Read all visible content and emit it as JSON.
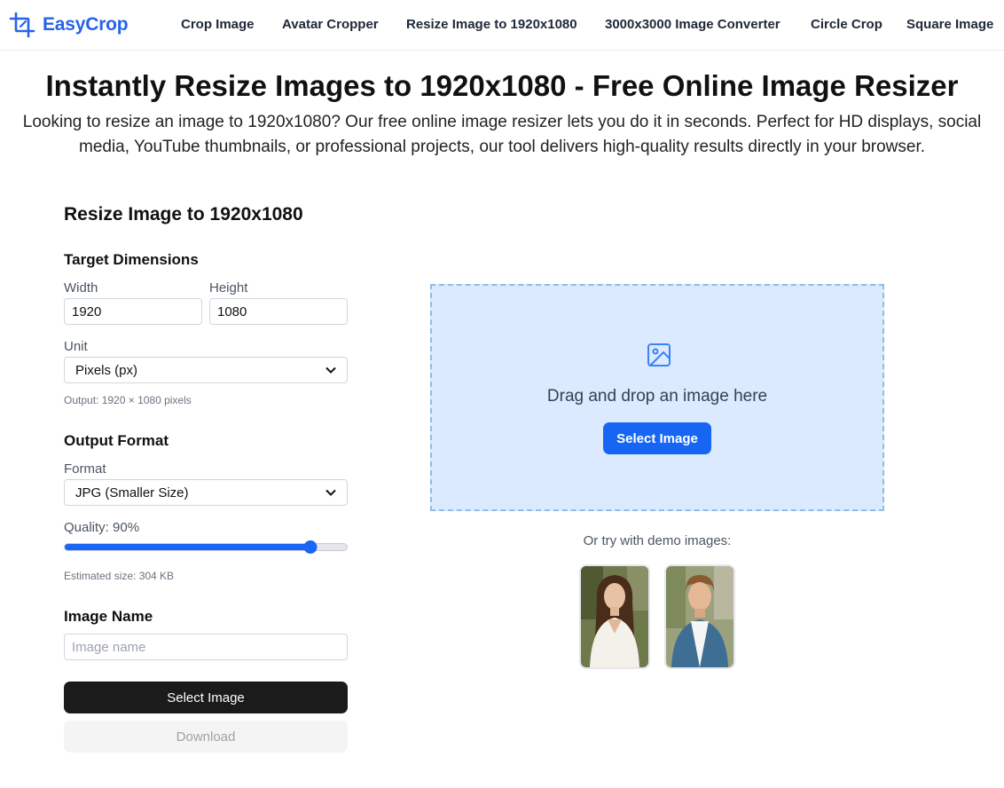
{
  "header": {
    "logo_text": "EasyCrop",
    "nav": [
      {
        "label": "Crop Image"
      },
      {
        "label": "Avatar Cropper"
      },
      {
        "label": "Resize Image to 1920x1080"
      },
      {
        "label": "3000x3000 Image Converter"
      },
      {
        "label": "Circle Crop"
      },
      {
        "label": "Square Image"
      }
    ]
  },
  "hero": {
    "title": "Instantly Resize Images to 1920x1080 - Free Online Image Resizer",
    "subtitle": "Looking to resize an image to 1920x1080? Our free online image resizer lets you do it in seconds. Perfect for HD displays, social media, YouTube thumbnails, or professional projects, our tool delivers high-quality results directly in your browser."
  },
  "panel": {
    "title": "Resize Image to 1920x1080",
    "dimensions": {
      "title": "Target Dimensions",
      "width_label": "Width",
      "width_value": "1920",
      "height_label": "Height",
      "height_value": "1080",
      "unit_label": "Unit",
      "unit_value": "Pixels (px)",
      "output_hint": "Output: 1920 × 1080 pixels"
    },
    "format": {
      "title": "Output Format",
      "format_label": "Format",
      "format_value": "JPG (Smaller Size)",
      "quality_label": "Quality: 90%",
      "quality_value": 90,
      "estimated_size": "Estimated size: 304 KB"
    },
    "image_name": {
      "title": "Image Name",
      "placeholder": "Image name",
      "value": ""
    },
    "select_button": "Select Image",
    "download_button": "Download"
  },
  "dropzone": {
    "text": "Drag and drop an image here",
    "button": "Select Image",
    "icon": "image-icon"
  },
  "demo": {
    "label": "Or try with demo images:",
    "images": [
      {
        "icon": "woman-portrait-photo"
      },
      {
        "icon": "man-portrait-photo"
      }
    ]
  },
  "colors": {
    "brand": "#2563eb",
    "dropzone_bg": "#dbeafe",
    "primary_button": "#1766f3",
    "dark_button": "#1b1b1b"
  }
}
